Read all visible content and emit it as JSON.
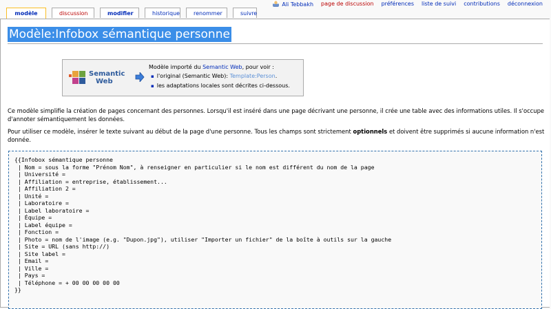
{
  "tabs": [
    {
      "label": "modèle",
      "selected": true,
      "red": false
    },
    {
      "label": "discussion",
      "selected": false,
      "red": true
    },
    {
      "label": "modifier",
      "selected": false,
      "red": false
    },
    {
      "label": "historique",
      "selected": false,
      "red": false
    },
    {
      "label": "renommer",
      "selected": false,
      "red": false
    },
    {
      "label": "suivre",
      "selected": false,
      "red": false
    }
  ],
  "personal": {
    "user": "Ali Tebbakh",
    "talk": "page de discussion",
    "prefs": "préférences",
    "watchlist": "liste de suivi",
    "contributions": "contributions",
    "logout": "déconnexion"
  },
  "page_title": "Modèle:Infobox sémantique personne",
  "import_box": {
    "logo_word1": "Semantic",
    "logo_word2": "Web",
    "intro_prefix": "Modèle importé du ",
    "intro_link": "Semantic Web",
    "intro_suffix": ", pour voir :",
    "item1_prefix": "l'original (Semantic Web): ",
    "item1_link": "Template:Person",
    "item1_suffix": ".",
    "item2": "les adaptations locales sont décrites ci-dessous."
  },
  "para1": "Ce modèle simplifie la création de pages concernant des personnes. Lorsqu'il est inséré dans une page décrivant une personne, il crée une table avec des informations utiles. Il s'occupe d'annoter sémantiquement les données.",
  "para2_prefix": "Pour utiliser ce modèle, insérer le texte suivant au début de la page d'une personne. Tous les champs sont strictement ",
  "para2_bold": "optionnels",
  "para2_suffix": " et doivent être supprimés si aucune information n'est donnée.",
  "code_lines": [
    "{{Infobox sémantique personne",
    " | Nom = sous la forme \"Prénom Nom\", à renseigner en particulier si le nom est différent du nom de la page",
    " | Université =",
    " | Affiliation = entreprise, établissement...",
    " | Affiliation 2 =",
    " | Unité =",
    " | Laboratoire =",
    " | Label laboratoire =",
    " | Équipe =",
    " | Label équipe =",
    " | Fonction =",
    " | Photo = nom de l'image (e.g. \"Dupon.jpg\"), utiliser \"Importer un fichier\" de la boîte à outils sur la gauche",
    " | Site = URL (sans http://)",
    " | Site label =",
    " | Email =",
    " | Ville =",
    " | Pays =",
    " | Téléphone = + 00 00 00 00 00",
    "}}"
  ]
}
